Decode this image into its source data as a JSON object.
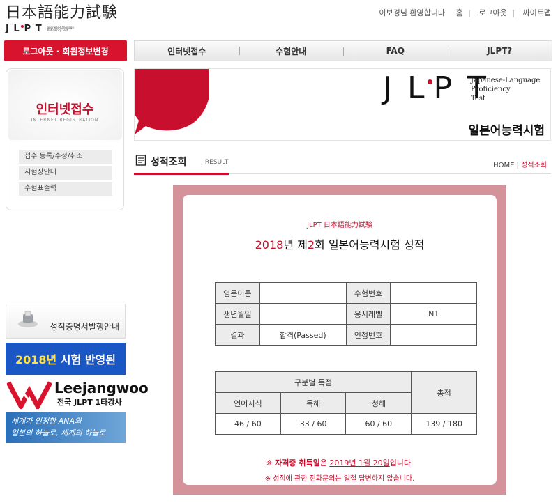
{
  "header": {
    "logo_jp": "日本語能力試験",
    "logo_jlpt": "JLPT",
    "logo_tiny": "Japanese-Language Proficiency Test",
    "welcome": "이보경님 환영합니다",
    "links": [
      "홈",
      "로그아웃",
      "싸이트맵"
    ]
  },
  "login_button": "로그아웃 · 회원정보변경",
  "nav": [
    "인터넷접수",
    "수험안내",
    "FAQ",
    "JLPT?"
  ],
  "left": {
    "title": "인터넷접수",
    "subtitle": "INTERNET REGISTRATION",
    "menu": [
      "접수 등록/수정/취소",
      "시험장안내",
      "수험표출력"
    ]
  },
  "banners": {
    "cert": "성적증명서발행안내",
    "result_year": "2018년",
    "result_text": "시험 반영된",
    "lee_name": "Leejangwoo",
    "lee_sub_prefix": "전국",
    "lee_sub_bold": "JLPT",
    "lee_sub_suffix": "1타강사",
    "ana_line1": "세계가 인정한 ANA와",
    "ana_line2": "일본의 하늘로, 세계의 하늘로"
  },
  "main_banner": {
    "jlpt": "JLPT",
    "eng_line1": "Japanese-Language",
    "eng_line2": "Proficiency",
    "eng_line3": "Test",
    "kr": "일본어능력시험"
  },
  "page_title": {
    "title": "성적조회",
    "sub": "| RESULT",
    "crumb_home": "HOME",
    "crumb_sep": " | ",
    "crumb_current": "성적조회"
  },
  "cert": {
    "header": "JLPT 日本語能力試験",
    "title_year": "2018",
    "title_mid": "년  제",
    "title_num": "2",
    "title_end": "회  일본어능력시험  성적",
    "info": {
      "name_label": "영문이름",
      "name_value": "",
      "exam_no_label": "수험번호",
      "exam_no_value": "",
      "birth_label": "생년월일",
      "birth_value": "",
      "level_label": "응시레벨",
      "level_value": "N1",
      "result_label": "결과",
      "result_value": "합격(Passed)",
      "cert_no_label": "인정번호",
      "cert_no_value": ""
    },
    "scores": {
      "section_header": "구분별 득점",
      "total_header": "총점",
      "categories": [
        "언어지식",
        "독해",
        "청해"
      ],
      "values": [
        "46 / 60",
        "33 / 60",
        "60 / 60"
      ],
      "total": "139 / 180"
    },
    "note1_prefix": "※ ",
    "note1_bold": "자격증 취득일",
    "note1_mid": "은 ",
    "note1_date": "2019년 1월 20일",
    "note1_suffix": "입니다.",
    "note2": "※ 성적에 관한 전화문의는 일절 답변하지 않습니다."
  }
}
